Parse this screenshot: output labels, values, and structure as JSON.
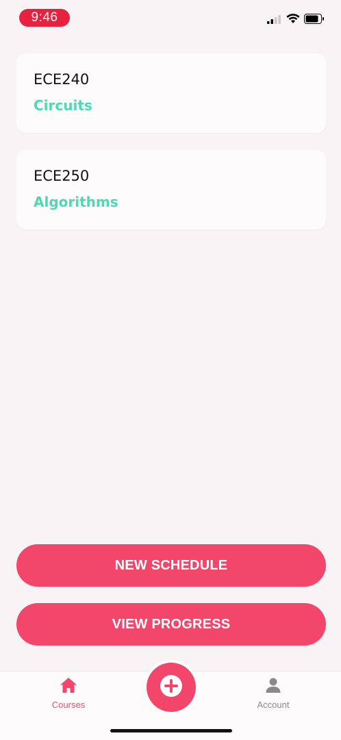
{
  "status_bar": {
    "time": "9:46",
    "icons": [
      "signal-icon",
      "wifi-icon",
      "battery-icon"
    ]
  },
  "courses": [
    {
      "code": "ECE240",
      "name": "Circuits"
    },
    {
      "code": "ECE250",
      "name": "Algorithms"
    }
  ],
  "actions": {
    "new_schedule": "NEW SCHEDULE",
    "view_progress": "VIEW PROGRESS"
  },
  "tab_bar": {
    "courses_label": "Courses",
    "account_label": "Account",
    "add_icon": "plus-icon"
  },
  "colors": {
    "accent": "#f2476a",
    "course_name": "#4fd8b4",
    "time_pill": "#e8213f",
    "inactive_tab": "#8a8a8a"
  }
}
